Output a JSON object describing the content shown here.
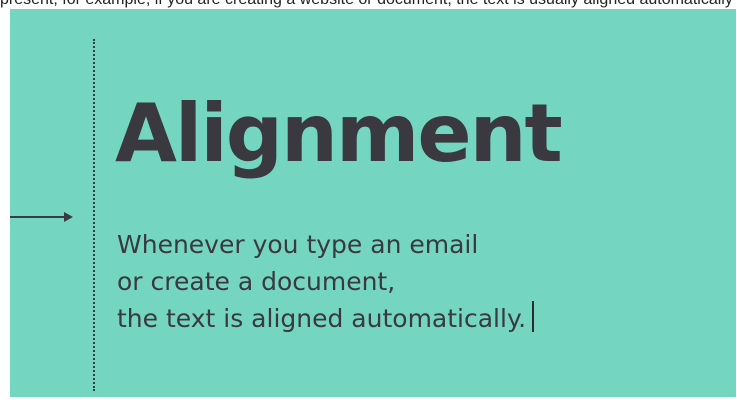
{
  "caption": {
    "text": "present; for example, if you are creating a website or document, the text is usually aligned automatically"
  },
  "slide": {
    "heading": "Alignment",
    "body_lines": [
      "Whenever you type an email",
      "or create a document,",
      "the text is aligned automatically."
    ]
  }
}
